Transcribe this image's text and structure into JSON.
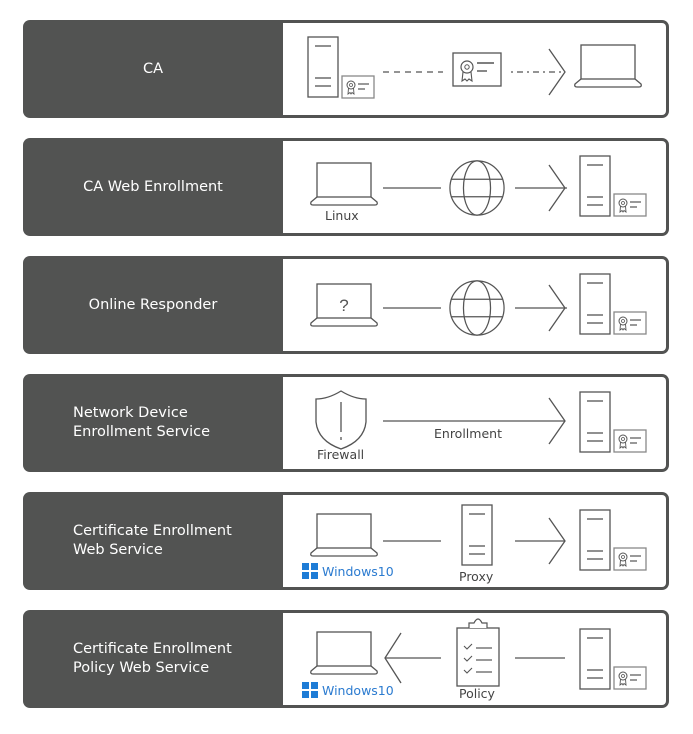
{
  "rows": [
    {
      "label_lines": [
        "CA"
      ],
      "flow": "CA server issues certificate to client device"
    },
    {
      "label_lines": [
        "CA Web Enrollment"
      ],
      "client_caption": "Linux"
    },
    {
      "label_lines": [
        "Online Responder"
      ],
      "client_glyph": "?"
    },
    {
      "label_lines": [
        "Network Device",
        "Enrollment Service"
      ],
      "shield_caption": "Firewall",
      "arrow_caption": "Enrollment"
    },
    {
      "label_lines": [
        "Certificate Enrollment",
        "Web Service"
      ],
      "client_caption": "Windows10",
      "middle_caption": "Proxy"
    },
    {
      "label_lines": [
        "Certificate Enrollment",
        "Policy Web Service"
      ],
      "client_caption": "Windows10",
      "middle_caption": "Policy"
    }
  ],
  "colors": {
    "row_background": "#525352",
    "label_text": "#ffffff",
    "icon_stroke": "#555555",
    "windows_blue": "#1e7cd6"
  }
}
